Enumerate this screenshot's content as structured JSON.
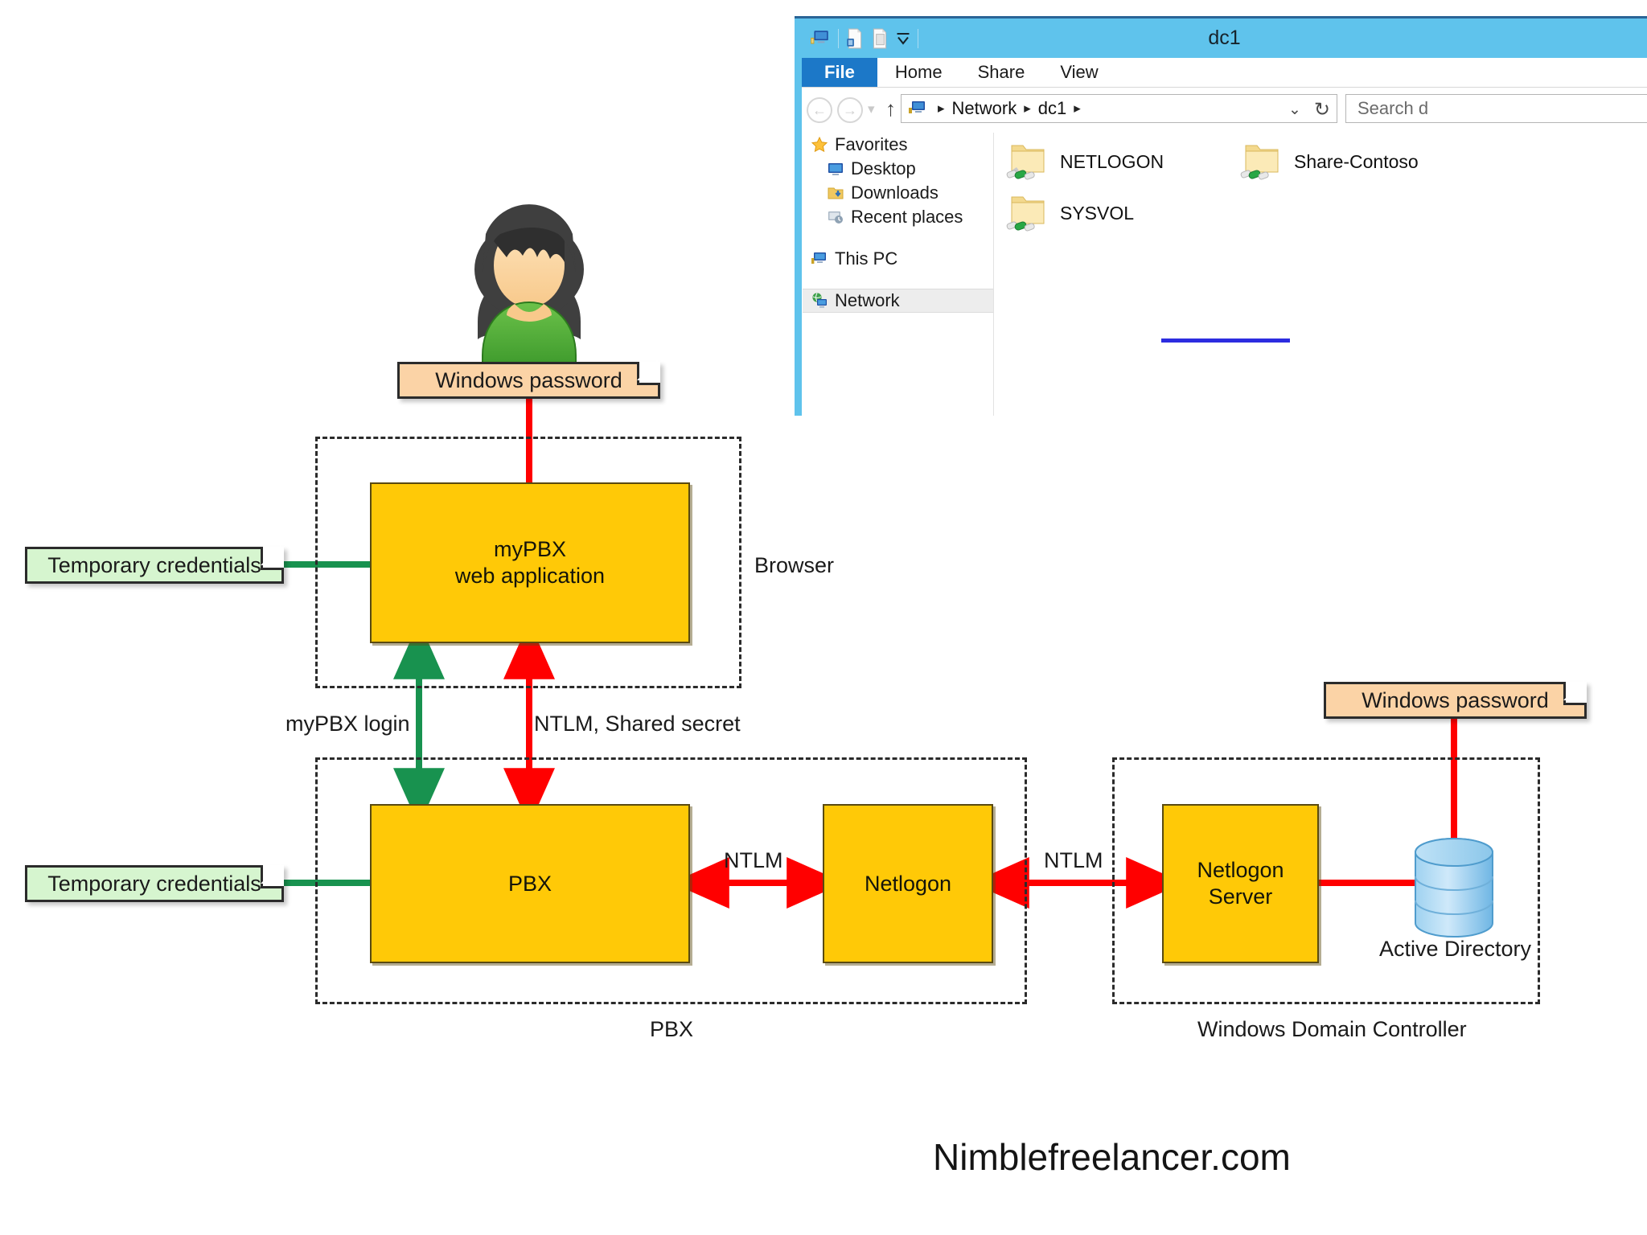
{
  "diagram": {
    "groups": [
      {
        "caption": "Browser"
      },
      {
        "caption": "PBX"
      },
      {
        "caption": "Windows Domain Controller"
      }
    ],
    "nodes": {
      "mypbx_web": "myPBX\nweb application",
      "pbx": "PBX",
      "netlogon": "Netlogon",
      "netlogon_server": "Netlogon\nServer",
      "active_directory": "Active Directory"
    },
    "notes": {
      "windows_password_top": "Windows password",
      "windows_password_right": "Windows password",
      "temp_credentials_browser": "Temporary credentials",
      "temp_credentials_pbx": "Temporary credentials"
    },
    "edge_labels": {
      "mypbx_login": "myPBX login",
      "ntlm_shared_secret": "NTLM, Shared secret",
      "ntlm_pbx_netlogon": "NTLM",
      "ntlm_netlogon_server": "NTLM"
    },
    "colors": {
      "node_fill": "#FFC907",
      "red_link": "#FF0000",
      "green_link": "#18924F",
      "note_green": "#D6F5CF",
      "note_orange": "#FBD3A6"
    },
    "watermark": "Nimblefreelancer.com"
  },
  "explorer": {
    "title": "dc1",
    "ribbon_tabs": [
      "File",
      "Home",
      "Share",
      "View"
    ],
    "address": {
      "crumbs": [
        "Network",
        "dc1"
      ],
      "history_dropdown": "⌄",
      "refresh": "↻"
    },
    "search": {
      "placeholder": "Search d"
    },
    "nav_pane": {
      "groups": [
        {
          "label": "Favorites",
          "icon": "star-icon",
          "children": [
            {
              "label": "Desktop",
              "icon": "desktop-icon"
            },
            {
              "label": "Downloads",
              "icon": "downloads-icon"
            },
            {
              "label": "Recent places",
              "icon": "recent-places-icon"
            }
          ]
        },
        {
          "label": "This PC",
          "icon": "this-pc-icon",
          "children": []
        },
        {
          "label": "Network",
          "icon": "network-icon",
          "children": [],
          "selected": true
        }
      ]
    },
    "files": [
      {
        "name": "NETLOGON",
        "icon": "shared-folder-icon"
      },
      {
        "name": "Share-Contoso",
        "icon": "shared-folder-icon"
      },
      {
        "name": "SYSVOL",
        "icon": "shared-folder-icon"
      }
    ],
    "accent_color": "#5FC3EC",
    "file_tab_color": "#1C78C8"
  }
}
